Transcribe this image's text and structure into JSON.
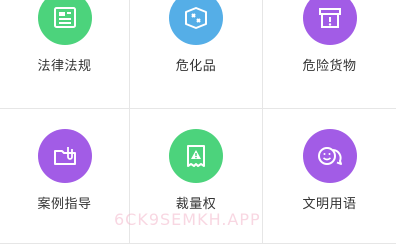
{
  "grid": {
    "items": [
      {
        "label": "法律法规",
        "icon": "document-list-icon",
        "color": "#4cd37c"
      },
      {
        "label": "危化品",
        "icon": "hazard-box-icon",
        "color": "#55aee7"
      },
      {
        "label": "危险货物",
        "icon": "warning-box-icon",
        "color": "#a25ce6"
      },
      {
        "label": "案例指导",
        "icon": "folder-clip-icon",
        "color": "#a25ce6"
      },
      {
        "label": "裁量权",
        "icon": "receipt-warning-icon",
        "color": "#4cd37c"
      },
      {
        "label": "文明用语",
        "icon": "chat-smile-icon",
        "color": "#a25ce6"
      }
    ]
  },
  "watermark": {
    "text": "6CK9SEMKH.APP"
  }
}
